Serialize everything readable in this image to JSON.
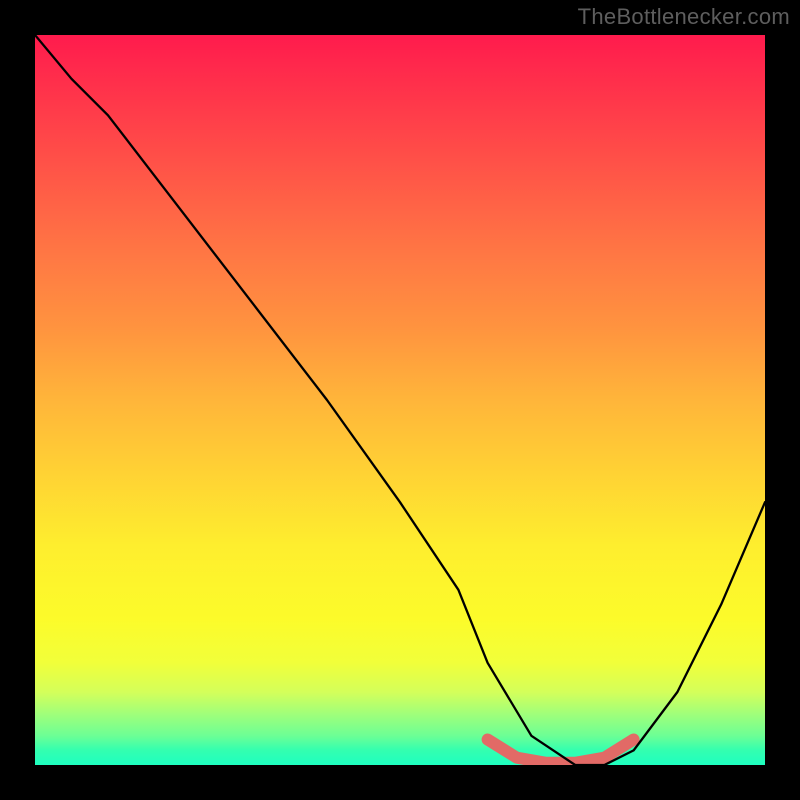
{
  "watermark": "TheBottlenecker.com",
  "chart_data": {
    "type": "line",
    "title": "",
    "xlabel": "",
    "ylabel": "",
    "xlim": [
      0,
      100
    ],
    "ylim": [
      0,
      100
    ],
    "series": [
      {
        "name": "curve",
        "color": "#000000",
        "x": [
          0,
          5,
          10,
          20,
          30,
          40,
          50,
          58,
          62,
          68,
          74,
          78,
          82,
          88,
          94,
          100
        ],
        "y": [
          100,
          94,
          89,
          76,
          63,
          50,
          36,
          24,
          14,
          4,
          0,
          0,
          2,
          10,
          22,
          36
        ]
      },
      {
        "name": "highlight",
        "color": "#e26a66",
        "x": [
          62,
          66,
          70,
          74,
          78,
          82
        ],
        "y": [
          3.5,
          1.0,
          0.3,
          0.3,
          1.0,
          3.5
        ]
      }
    ],
    "gradient_stops": [
      {
        "pct": 0,
        "color": "#ff1b4d"
      },
      {
        "pct": 50,
        "color": "#ffb53a"
      },
      {
        "pct": 80,
        "color": "#fcfb2a"
      },
      {
        "pct": 100,
        "color": "#1effc0"
      }
    ]
  }
}
